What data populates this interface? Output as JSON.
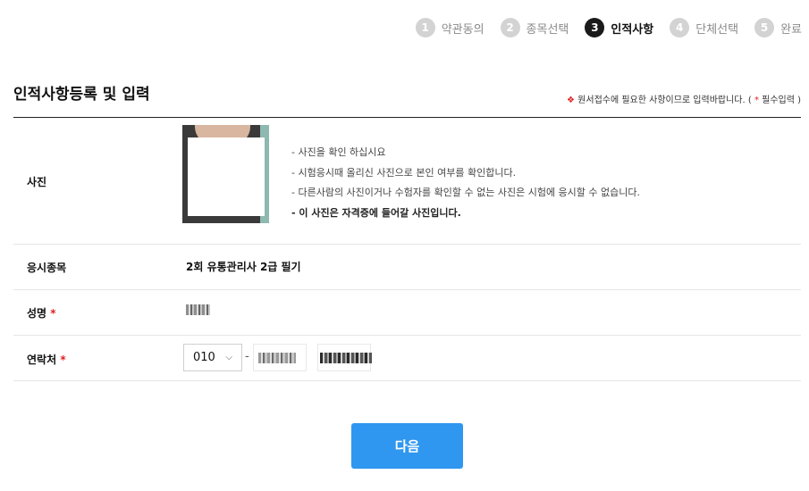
{
  "steps": [
    {
      "num": "1",
      "label": "약관동의"
    },
    {
      "num": "2",
      "label": "종목선택"
    },
    {
      "num": "3",
      "label": "인적사항"
    },
    {
      "num": "4",
      "label": "단체선택"
    },
    {
      "num": "5",
      "label": "완료"
    }
  ],
  "active_step": 3,
  "heading": {
    "title": "인적사항등록 및 입력",
    "notice_mark": "❖",
    "notice_text": " 원서접수에 필요한 사항이므로 입력바랍니다. ( ",
    "notice_star": "*",
    "notice_end": " 필수입력 )"
  },
  "photo": {
    "label": "사진",
    "notes": [
      "- 사진을 확인 하십시요",
      "- 시험응시때 올리신 사진으로 본인 여부를 확인합니다.",
      "- 다른사람의 사진이거나 수험자를 확인할 수 없는 사진은 시험에 응시할 수 없습니다.",
      "- 이 사진은 자격증에 들어갈 사진입니다."
    ]
  },
  "exam": {
    "label": "응시종목",
    "value": "2회 유통관리사 2급 필기"
  },
  "name": {
    "label": "성명",
    "required": "*"
  },
  "phone": {
    "label": "연락처",
    "required": "*",
    "prefix": "010",
    "dash": "-"
  },
  "next_button": "다음",
  "colors": {
    "accent": "#2f97f0",
    "required": "#e02020",
    "active_step": "#1a1a1a"
  }
}
